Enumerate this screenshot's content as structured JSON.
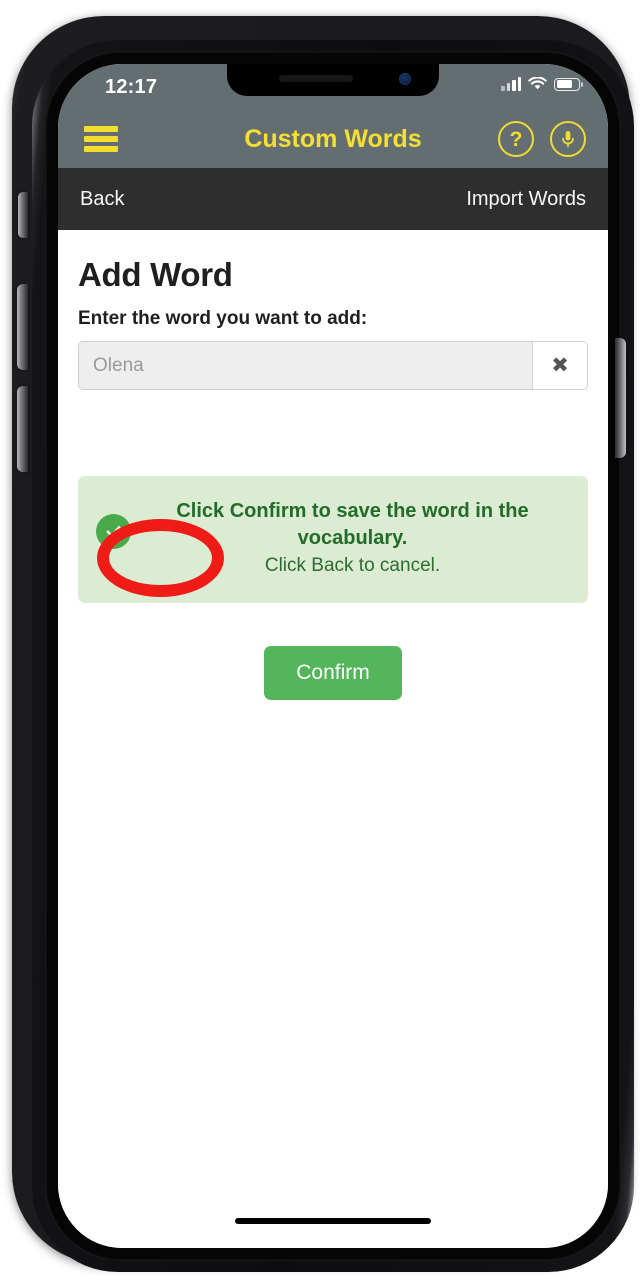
{
  "status_bar": {
    "time": "12:17",
    "signal_icon": "cellular-signal-icon",
    "wifi_icon": "wifi-icon",
    "battery_icon": "battery-icon",
    "battery_level_percent": 72
  },
  "app_header": {
    "title": "Custom Words",
    "menu_icon": "hamburger-menu-icon",
    "help_icon": "question-mark-icon",
    "help_glyph": "?",
    "microphone_icon": "microphone-icon",
    "background_color": "#646e71",
    "accent_color": "#f0dc34"
  },
  "nav_bar": {
    "back_label": "Back",
    "import_label": "Import Words",
    "background_color": "#2e2e2e"
  },
  "main": {
    "page_title": "Add Word",
    "field_label": "Enter the word you want to add:",
    "word_input": {
      "value": "Olena",
      "placeholder": "Olena"
    },
    "clear_button_glyph": "✖",
    "alert": {
      "icon": "check-circle-icon",
      "primary_text": "Click Confirm to save the word in the vocabulary.",
      "secondary_text": "Click Back to cancel.",
      "background_color": "#dcecd2",
      "text_color": "#226b2a"
    },
    "confirm_button_label": "Confirm",
    "confirm_button_color": "#53b65a"
  },
  "annotation": {
    "shape": "ellipse",
    "color": "#ee1b17",
    "target": "word-input"
  }
}
